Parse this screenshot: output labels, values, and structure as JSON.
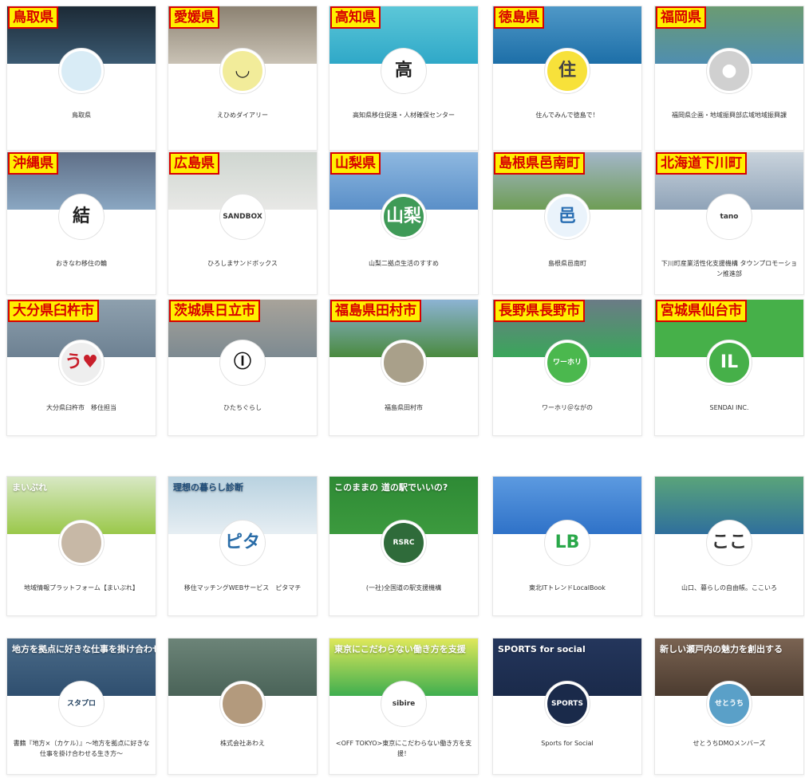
{
  "rows": [
    {
      "cards": [
        {
          "tag": "鳥取県",
          "name": "鳥取県",
          "icon": "landscape-photo",
          "glyph": "",
          "cover": "#3b5a72",
          "cover2": "#1c2a36",
          "avatar": "#d9ecf6",
          "glyph_color": "#4e7fa1"
        },
        {
          "tag": "愛媛県",
          "name": "えひめダイアリー",
          "icon": "mustache-face-icon",
          "glyph": "◡",
          "cover": "#c9c2b5",
          "cover2": "#8c8272",
          "avatar": "#f2ec9a",
          "glyph_color": "#222"
        },
        {
          "tag": "高知県",
          "name": "高知県移住促進・人材確保センター",
          "icon": "kanji-taka-logo",
          "glyph": "高",
          "cover": "#2fa8c8",
          "cover2": "#5cc7d8",
          "avatar": "#ffffff",
          "glyph_color": "#222"
        },
        {
          "tag": "徳島県",
          "name": "住んでみんで徳島で！",
          "icon": "speech-sign-icon",
          "glyph": "住",
          "cover": "#1d6fa8",
          "cover2": "#4f98c7",
          "avatar": "#f7e13a",
          "glyph_color": "#444"
        },
        {
          "tag": "福岡県",
          "name": "福岡県企画・地域振興部広域地域振興課",
          "icon": "default-user-icon",
          "glyph": "●",
          "cover": "#4f8eb0",
          "cover2": "#6b9b72",
          "avatar": "#d0d0d0",
          "glyph_color": "#ffffff"
        }
      ]
    },
    {
      "cards": [
        {
          "tag": "沖縄県",
          "name": "おきなわ移住の輪",
          "icon": "musubi-kanji-logo",
          "glyph": "結",
          "cover": "#8aa7c2",
          "cover2": "#5f6f87",
          "avatar": "#ffffff",
          "glyph_color": "#222"
        },
        {
          "tag": "広島県",
          "name": "ひろしまサンドボックス",
          "icon": "sandbox-logo",
          "glyph": "SANDBOX",
          "cover": "#e8e8e6",
          "cover2": "#cfd6d0",
          "avatar": "#ffffff",
          "glyph_color": "#333"
        },
        {
          "tag": "山梨県",
          "name": "山梨二拠点生活のすすめ",
          "icon": "green-circle-logo",
          "glyph": "山梨",
          "cover": "#5a8fc8",
          "cover2": "#8eb8e0",
          "avatar": "#3f9a57",
          "glyph_color": "#ffffff"
        },
        {
          "tag": "島根県邑南町",
          "name": "島根県邑南町",
          "icon": "ohnan-town-logo",
          "glyph": "邑",
          "cover": "#6e9d55",
          "cover2": "#a3b6c9",
          "avatar": "#eaf3fb",
          "glyph_color": "#2a6fb3"
        },
        {
          "tag": "北海道下川町",
          "name": "下川町産業活性化支援機構 タウンプロモーション推進部",
          "icon": "tanoshimo-logo",
          "glyph": "tano",
          "cover": "#8fa3b8",
          "cover2": "#c9d3dc",
          "avatar": "#ffffff",
          "glyph_color": "#333"
        }
      ]
    },
    {
      "cards": [
        {
          "tag": "大分県臼杵市",
          "name": "大分県臼杵市　移住担当",
          "icon": "heart-logo",
          "glyph": "う♥",
          "cover": "#6d8192",
          "cover2": "#8ea0ae",
          "avatar": "#eeeeee",
          "glyph_color": "#c81e2a"
        },
        {
          "tag": "茨城県日立市",
          "name": "ひたちぐらし",
          "icon": "hitachi-crest-icon",
          "glyph": "Ⓘ",
          "cover": "#7d8a91",
          "cover2": "#a8a39a",
          "avatar": "#ffffff",
          "glyph_color": "#111"
        },
        {
          "tag": "福島県田村市",
          "name": "福島県田村市",
          "icon": "building-photo",
          "glyph": "",
          "cover": "#4a8a3f",
          "cover2": "#8cb3d3",
          "avatar": "#a9a08a",
          "glyph_color": "#fff"
        },
        {
          "tag": "長野県長野市",
          "name": "ワーホリ＠ながの",
          "icon": "workholi-logo",
          "glyph": "ワーホリ",
          "cover": "#3aa65a",
          "cover2": "#6b7b86",
          "avatar": "#4bb84e",
          "glyph_color": "#ffffff"
        },
        {
          "tag": "宮城県仙台市",
          "name": "SENDAI INC.",
          "icon": "sendai-logo",
          "glyph": "IL",
          "cover": "#46b049",
          "cover2": "#46b049",
          "avatar": "#46b049",
          "glyph_color": "#ffffff"
        }
      ]
    },
    {
      "cards": [
        {
          "tag": "",
          "name": "地域情報プラットフォーム【まいぷれ】",
          "icon": "people-photo",
          "glyph": "",
          "cover": "#9ac84a",
          "cover2": "#d8e8c4",
          "avatar": "#c7b8a6",
          "glyph_color": "#333",
          "cover_text": "まいぷれ"
        },
        {
          "tag": "",
          "name": "移住マッチングWEBサービス　ピタマチ",
          "icon": "pitamachi-logo",
          "glyph": "ピタ",
          "cover": "#e6eef3",
          "cover2": "#b9d2e0",
          "avatar": "#ffffff",
          "glyph_color": "#2a6da8",
          "cover_text": "理想の暮らし診断"
        },
        {
          "tag": "",
          "name": "(一社)全国道の駅支援機構",
          "icon": "rsrc-logo",
          "glyph": "RSRC",
          "cover": "#3c9a3e",
          "cover2": "#2e8a35",
          "avatar": "#2f6b3a",
          "glyph_color": "#ffffff",
          "cover_text": "このままの 道の駅でいいの?"
        },
        {
          "tag": "",
          "name": "東北ITトレンドLocalBook",
          "icon": "lb-logo",
          "glyph": "LB",
          "cover": "#2f72c8",
          "cover2": "#5c9ae0",
          "avatar": "#ffffff",
          "glyph_color": "#2aa84a"
        },
        {
          "tag": "",
          "name": "山口、暮らしの自由帳。ここいろ",
          "icon": "cocoiro-logo",
          "glyph": "ここ",
          "cover": "#2f6f9c",
          "cover2": "#5aa47a",
          "avatar": "#ffffff",
          "glyph_color": "#333"
        }
      ]
    },
    {
      "cards": [
        {
          "tag": "",
          "name": "書籍『地方×（カケル）』〜地方を拠点に好きな仕事を掛け合わせる生き方〜",
          "icon": "sutapro-logo",
          "glyph": "スタプロ",
          "cover": "#2f4f6f",
          "cover2": "#4a6a88",
          "avatar": "#ffffff",
          "glyph_color": "#1a3a5a",
          "cover_text": "地方を拠点に好きな仕事を掛け合わせる生き方"
        },
        {
          "tag": "",
          "name": "株式会社あわえ",
          "icon": "town-photo",
          "glyph": "",
          "cover": "#4a6358",
          "cover2": "#6c8478",
          "avatar": "#b39a7d",
          "glyph_color": "#fff"
        },
        {
          "tag": "",
          "name": "<OFF TOKYO>東京にこだわらない働き方を支援！",
          "icon": "sibire-logo",
          "glyph": "sibire",
          "cover": "#3fae4f",
          "cover2": "#dfe85a",
          "avatar": "#ffffff",
          "glyph_color": "#333",
          "cover_text": "東京にこだわらない働き方を支援"
        },
        {
          "tag": "",
          "name": "Sports for Social",
          "icon": "sports-social-logo",
          "glyph": "SPORTS",
          "cover": "#1a2a4a",
          "cover2": "#24365c",
          "avatar": "#1a2a4a",
          "glyph_color": "#ffffff",
          "cover_text": "SPORTS for social"
        },
        {
          "tag": "",
          "name": "せとうちDMOメンバーズ",
          "icon": "setouchi-logo",
          "glyph": "せとうち",
          "cover": "#4b3b2f",
          "cover2": "#7a6352",
          "avatar": "#5aa0c8",
          "glyph_color": "#ffffff",
          "cover_text": "新しい瀬戸内の魅力を創出する"
        }
      ]
    }
  ]
}
